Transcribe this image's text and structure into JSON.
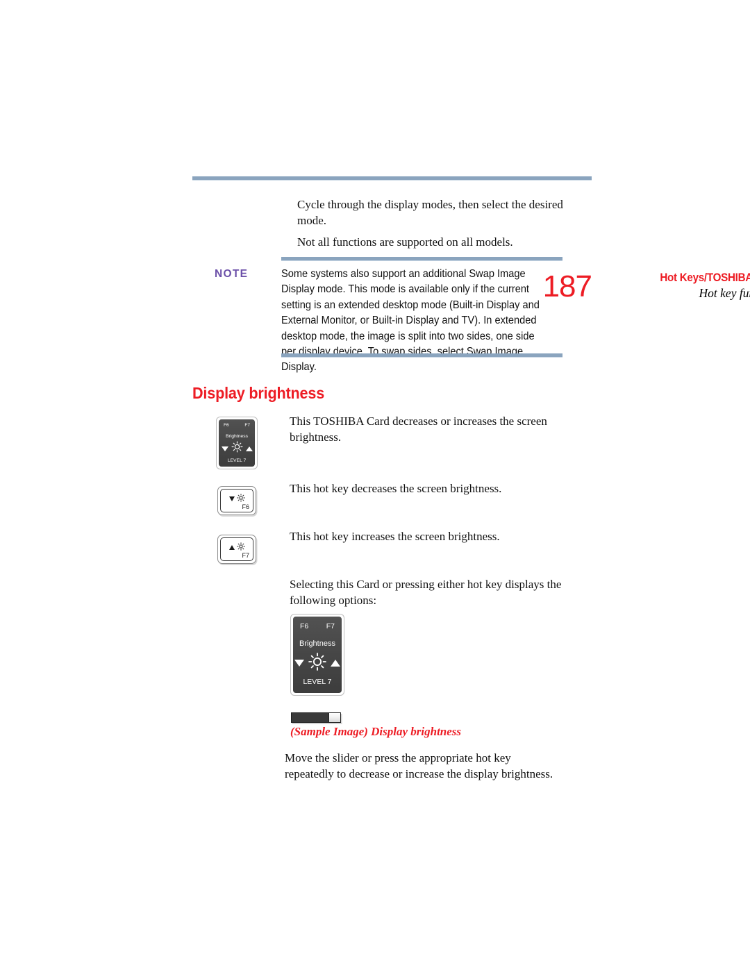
{
  "header": {
    "running_title": "Hot Keys/TOSHIBA Cards",
    "running_subtitle": "Hot key functions",
    "page_number": "187"
  },
  "body": {
    "p_cycle": "Cycle through the display modes, then select the desired mode.",
    "p_not_all": "Not all functions are supported on all models.",
    "p_card": "This TOSHIBA Card decreases or increases the screen brightness.",
    "p_decrease": "This hot key decreases the screen brightness.",
    "p_increase": "This hot key increases the screen brightness.",
    "p_select": "Selecting this Card or pressing either hot key displays the following options:",
    "p_move": "Move the slider or press the appropriate hot key repeatedly to decrease or increase the display brightness."
  },
  "note": {
    "label": "NOTE",
    "text": "Some systems also support an additional Swap Image Display mode. This mode is available only if the current setting is an extended desktop mode (Built-in Display and External Monitor, or Built-in Display and TV). In extended desktop mode, the image is split into two sides, one side per display device. To swap sides, select Swap Image Display."
  },
  "section": {
    "heading": "Display brightness"
  },
  "toshiba_card": {
    "fkey_left": "F6",
    "fkey_right": "F7",
    "title": "Brightness",
    "level": "LEVEL 7",
    "decrease_glyph": "down-triangle",
    "increase_glyph": "up-triangle",
    "brightness_glyph": "sun-icon"
  },
  "hotkeys": [
    {
      "name": "brightness-down-key",
      "fkey": "F6",
      "arrow": "down-triangle",
      "symbol": "sun-icon"
    },
    {
      "name": "brightness-up-key",
      "fkey": "F7",
      "arrow": "up-triangle",
      "symbol": "sun-icon"
    }
  ],
  "slider": {
    "caption": "(Sample Image) Display brightness",
    "fill_percent": 100
  },
  "colors": {
    "accent_red": "#ED1C24",
    "rule_blue": "#8AA4BE",
    "note_purple": "#6B4FA8",
    "card_grey": "#4a4a4a"
  }
}
